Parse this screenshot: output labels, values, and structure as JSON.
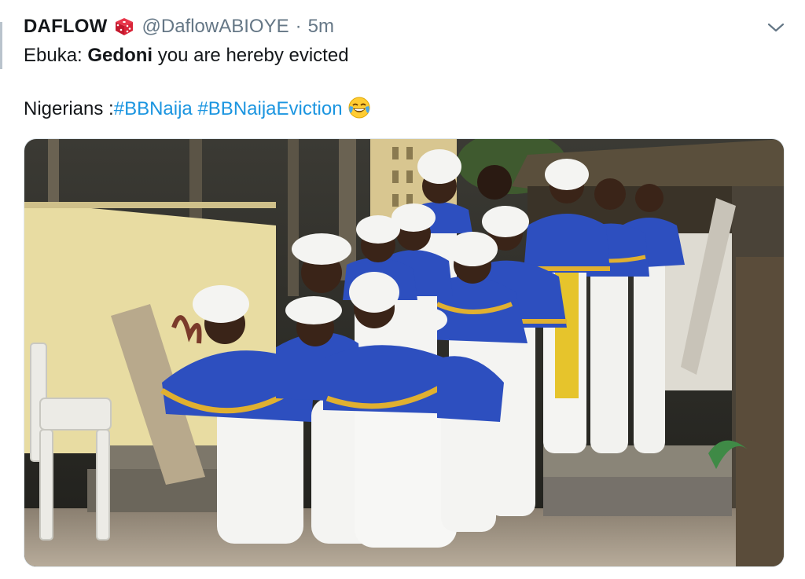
{
  "tweet": {
    "display_name": "DAFLOW",
    "badge_icon": "die-icon",
    "handle": "@DaflowABIOYE",
    "separator": "·",
    "time": "5m",
    "line1": {
      "prefix": "Ebuka: ",
      "bold": "Gedoni",
      "suffix": " you are hereby evicted"
    },
    "line2": {
      "prefix": "Nigerians :",
      "hashtag1": "#BBNaija",
      "space": " ",
      "hashtag2": "#BBNaijaEviction",
      "emoji": "face-with-tears-of-joy-emoji"
    }
  },
  "colors": {
    "hashtag": "#1b95e0",
    "muted": "#657786",
    "robe_blue": "#2d4fbf",
    "gold_trim": "#e0b030"
  }
}
